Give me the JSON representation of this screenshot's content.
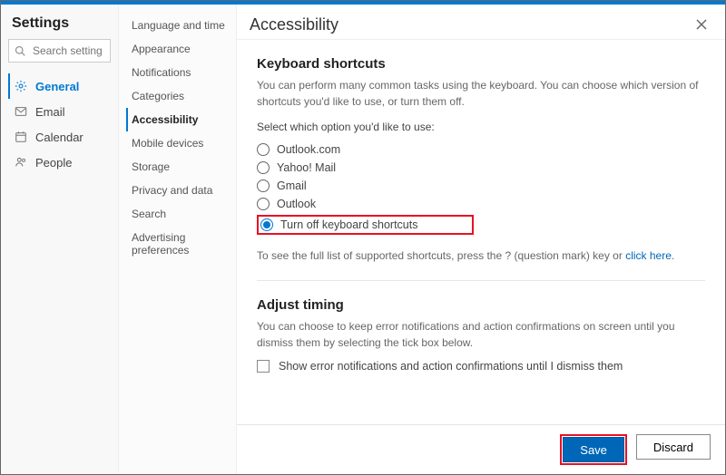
{
  "header": {
    "title": "Settings"
  },
  "search": {
    "placeholder": "Search settings"
  },
  "nav": {
    "items": [
      {
        "label": "General"
      },
      {
        "label": "Email"
      },
      {
        "label": "Calendar"
      },
      {
        "label": "People"
      }
    ]
  },
  "subnav": {
    "items": [
      {
        "label": "Language and time"
      },
      {
        "label": "Appearance"
      },
      {
        "label": "Notifications"
      },
      {
        "label": "Categories"
      },
      {
        "label": "Accessibility"
      },
      {
        "label": "Mobile devices"
      },
      {
        "label": "Storage"
      },
      {
        "label": "Privacy and data"
      },
      {
        "label": "Search"
      },
      {
        "label": "Advertising preferences"
      }
    ]
  },
  "panel": {
    "title": "Accessibility",
    "kb": {
      "heading": "Keyboard shortcuts",
      "description": "You can perform many common tasks using the keyboard. You can choose which version of shortcuts you'd like to use, or turn them off.",
      "select_label": "Select which option you'd like to use:",
      "options": [
        {
          "label": "Outlook.com"
        },
        {
          "label": "Yahoo! Mail"
        },
        {
          "label": "Gmail"
        },
        {
          "label": "Outlook"
        },
        {
          "label": "Turn off keyboard shortcuts"
        }
      ],
      "help_prefix": "To see the full list of supported shortcuts, press the ? (question mark) key or ",
      "help_link": "click here",
      "help_suffix": "."
    },
    "timing": {
      "heading": "Adjust timing",
      "description": "You can choose to keep error notifications and action confirmations on screen until you dismiss them by selecting the tick box below.",
      "checkbox_label": "Show error notifications and action confirmations until I dismiss them"
    }
  },
  "footer": {
    "save": "Save",
    "discard": "Discard"
  }
}
